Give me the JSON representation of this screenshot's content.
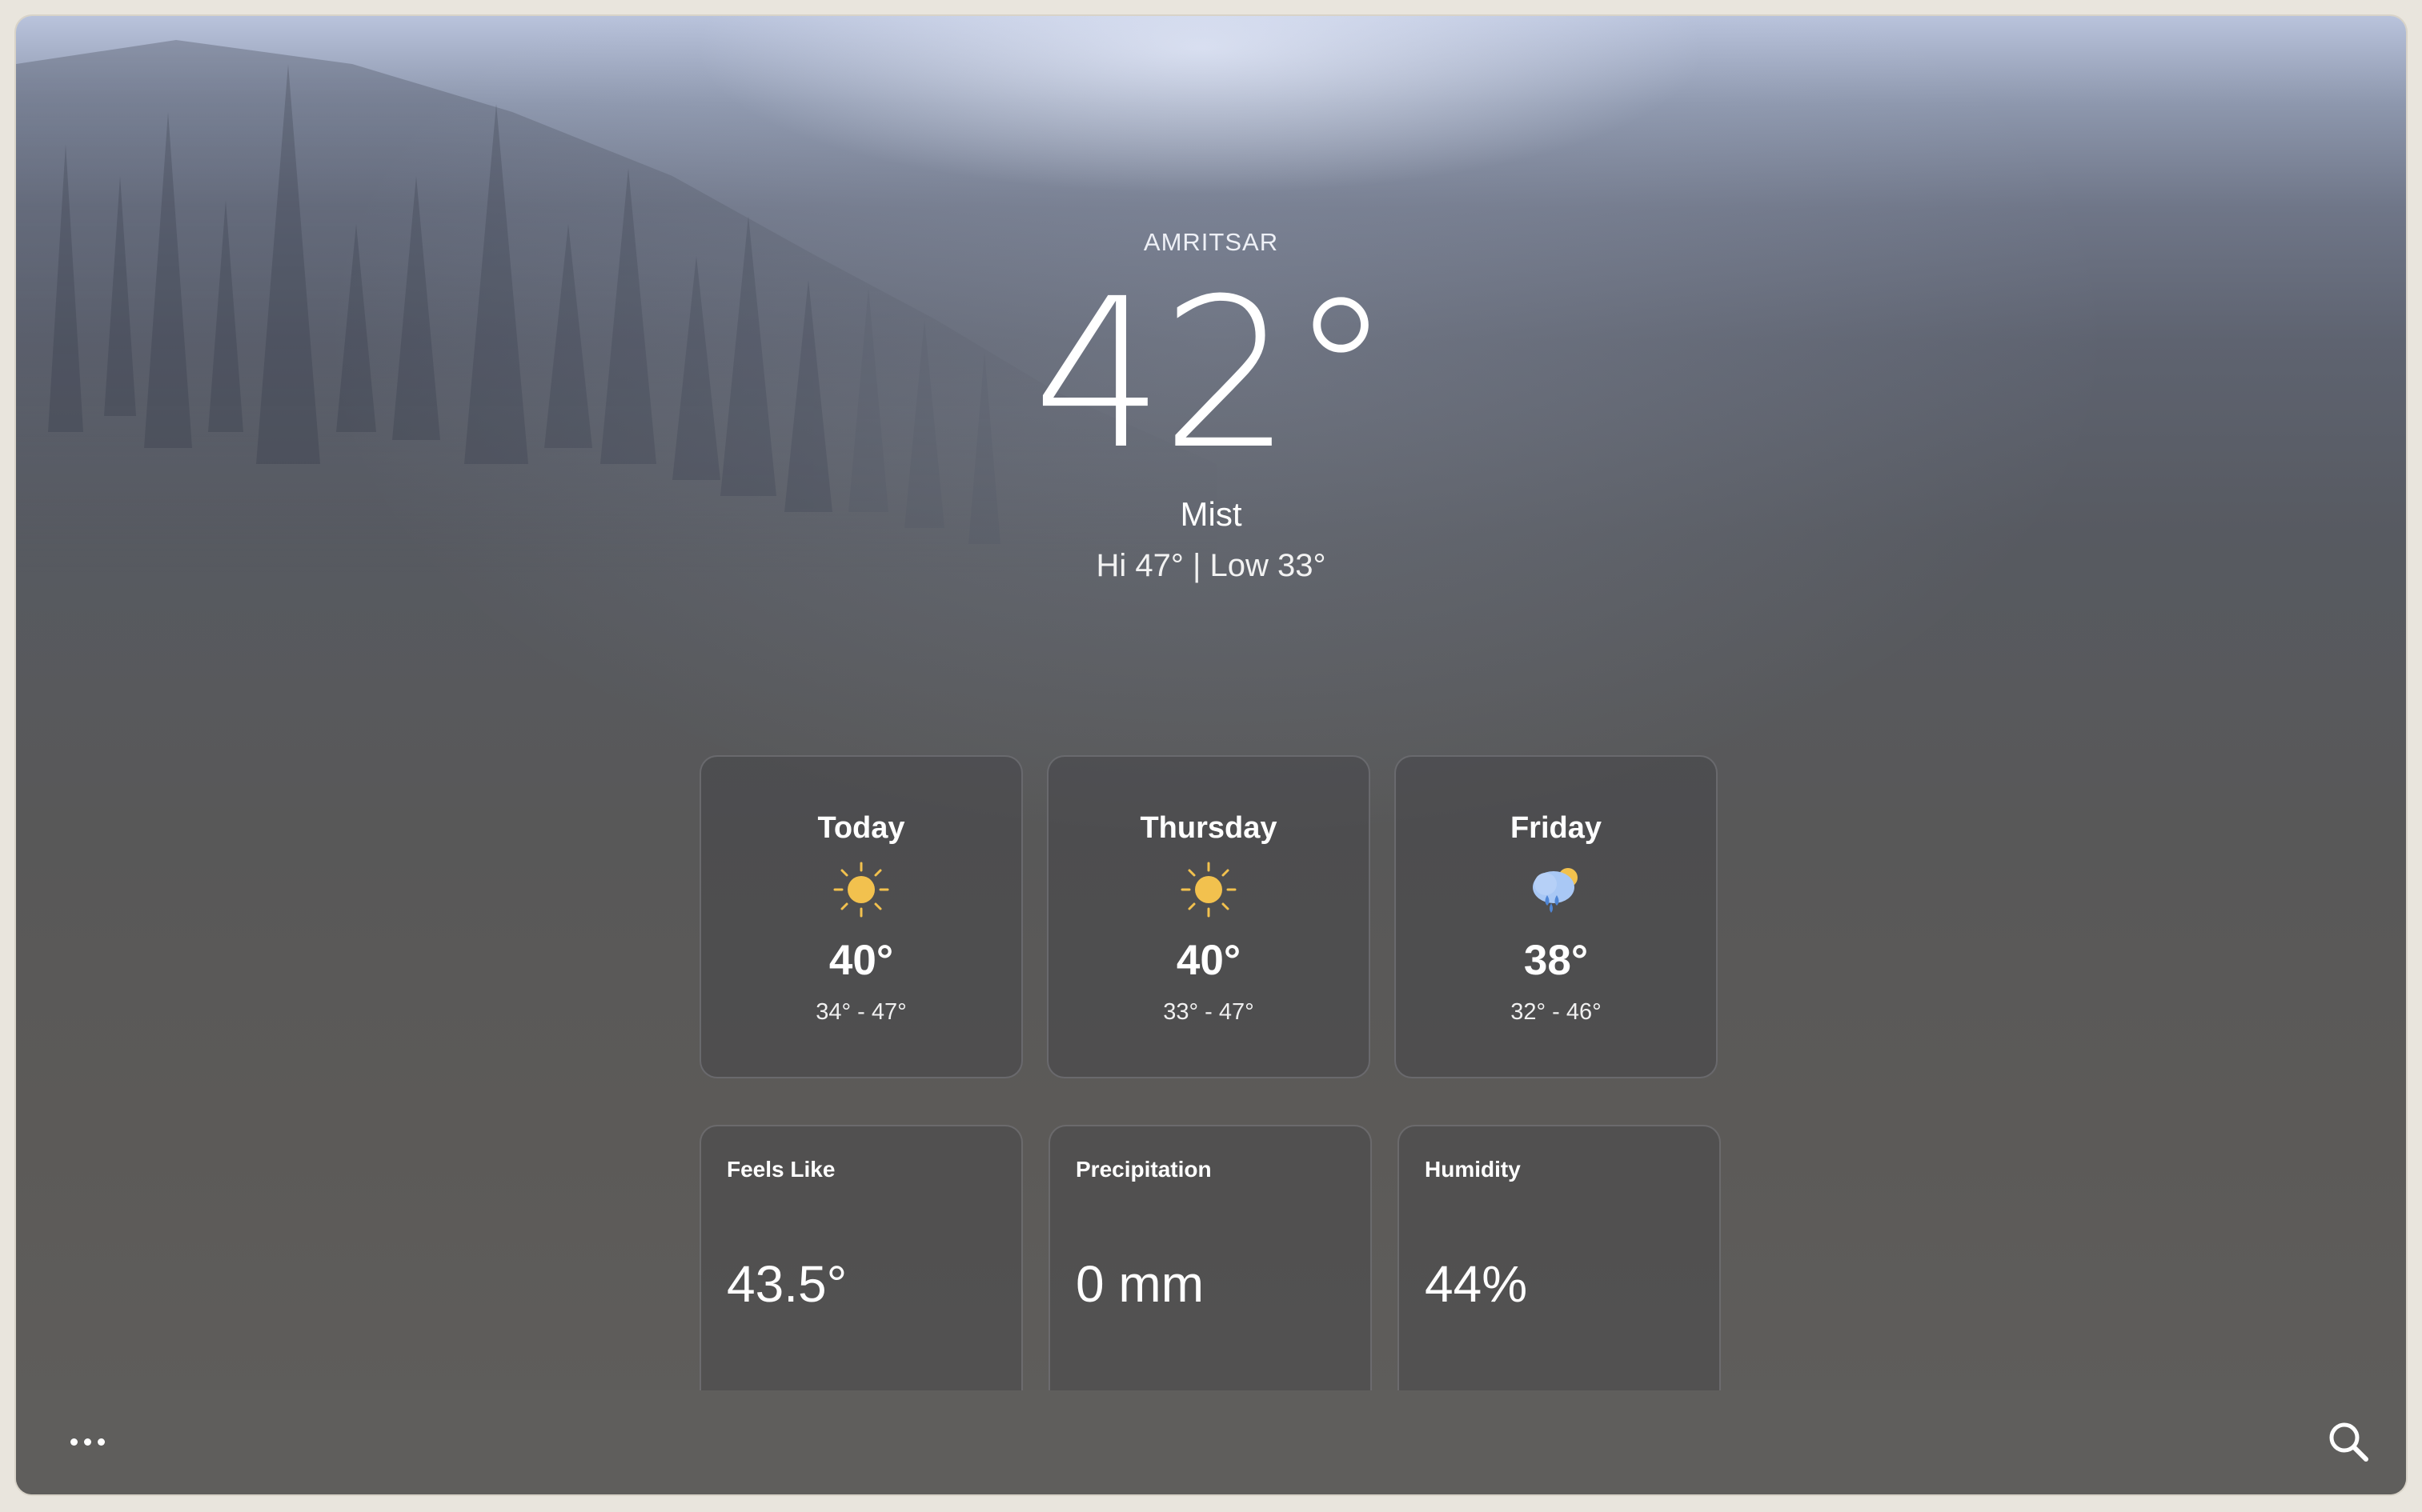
{
  "location": {
    "city": "AMRITSAR",
    "temperature": "42°",
    "condition": "Mist",
    "hi_low": "Hi 47° | Low 33°"
  },
  "forecast": [
    {
      "day": "Today",
      "icon": "sun-icon",
      "temp": "40°",
      "range": "34° - 47°"
    },
    {
      "day": "Thursday",
      "icon": "sun-icon",
      "temp": "40°",
      "range": "33° - 47°"
    },
    {
      "day": "Friday",
      "icon": "rain-cloud-sun-icon",
      "temp": "38°",
      "range": "32° - 46°"
    }
  ],
  "stats": [
    {
      "label": "Feels Like",
      "value": "43.5°"
    },
    {
      "label": "Precipitation",
      "value": "0 mm"
    },
    {
      "label": "Humidity",
      "value": "44%"
    }
  ],
  "toolbar": {
    "more_icon": "ellipsis-icon",
    "search_icon": "search-icon"
  },
  "colors": {
    "sun": "#f2c14e",
    "rain_cloud": "#a9c8f5",
    "rain_drop": "#4f86d6",
    "text": "#ffffff"
  }
}
